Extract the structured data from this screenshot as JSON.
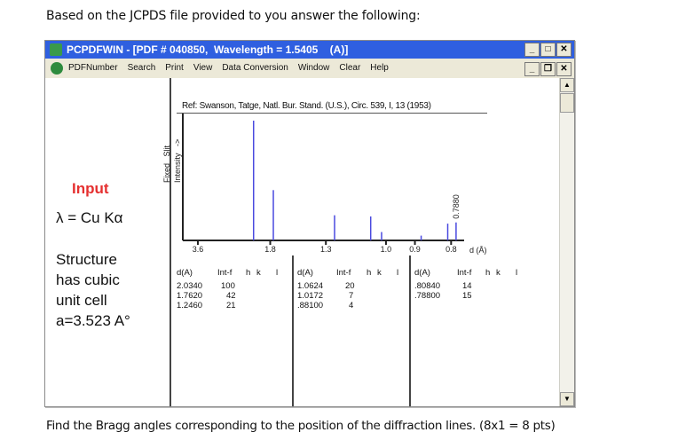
{
  "intro_text": "Based on the JCPDS file provided to you answer the following:",
  "question_text": "Find the Bragg angles corresponding to the position of the diffraction lines. (8x1 = 8 pts)",
  "window": {
    "title": "PCPDFWIN - [PDF # 040850,  Wavelength = 1.5405    (A)]",
    "title_buttons": {
      "minimize": "_",
      "maximize": "□",
      "close": "✕"
    },
    "mdi_buttons": {
      "minimize": "_",
      "restore": "❐",
      "close": "✕"
    },
    "menu": [
      "PDFNumber",
      "Search",
      "Print",
      "View",
      "Data Conversion",
      "Window",
      "Clear",
      "Help"
    ],
    "scrollbar": {
      "up": "▲",
      "down": "▼"
    }
  },
  "annotation": {
    "input_title": "Input",
    "lambda": "λ = Cu Kα",
    "structure_lines": [
      "Structure",
      "has cubic",
      "unit cell",
      "a=3.523 A°"
    ]
  },
  "reference": "Ref: Swanson, Tatge, Natl. Bur. Stand. (U.S.), Circ. 539, I, 13 (1953)",
  "chart_data": {
    "type": "bar",
    "title": "",
    "xlabel": "d (Å)",
    "ylabel": "Fixed Slit Intensity",
    "y_arrow": "->",
    "x_ticks": [
      "3.6",
      "1.8",
      "1.3",
      "1.0",
      "0.9",
      "0.8"
    ],
    "x_tick_values": [
      3.6,
      1.8,
      1.3,
      1.0,
      0.9,
      0.8
    ],
    "x_axis_scale": "1/d",
    "peaks": [
      {
        "d": 2.034,
        "intensity": 100
      },
      {
        "d": 1.762,
        "intensity": 42
      },
      {
        "d": 1.246,
        "intensity": 21
      },
      {
        "d": 1.0624,
        "intensity": 20
      },
      {
        "d": 1.0172,
        "intensity": 7
      },
      {
        "d": 0.881,
        "intensity": 4
      },
      {
        "d": 0.8084,
        "intensity": 14
      },
      {
        "d": 0.788,
        "intensity": 15
      }
    ],
    "annotations": [
      {
        "d": 0.788,
        "text": "0.7880"
      }
    ],
    "ylim": [
      0,
      100
    ]
  },
  "table": {
    "headers": {
      "d": "d(A)",
      "int": "Int-f",
      "h": "h",
      "k": "k",
      "l": "l"
    },
    "columns": [
      [
        {
          "d": "2.0340",
          "int": "100"
        },
        {
          "d": "1.7620",
          "int": "42"
        },
        {
          "d": "1.2460",
          "int": "21"
        }
      ],
      [
        {
          "d": "1.0624",
          "int": "20"
        },
        {
          "d": "1.0172",
          "int": "7"
        },
        {
          "d": ".88100",
          "int": "4"
        }
      ],
      [
        {
          "d": ".80840",
          "int": "14"
        },
        {
          "d": ".78800",
          "int": "15"
        }
      ]
    ]
  }
}
